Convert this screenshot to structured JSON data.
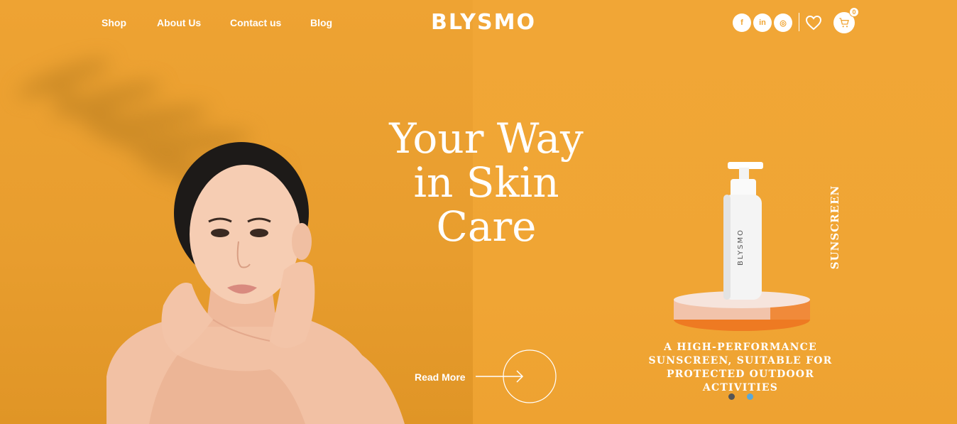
{
  "nav": {
    "links": [
      "Shop",
      "About Us",
      "Contact us",
      "Blog"
    ],
    "logo": "BLYSMO"
  },
  "social": {
    "facebook": "f",
    "linkedin": "in",
    "instagram": "◎"
  },
  "cart": {
    "count": "0"
  },
  "hero": {
    "headline": [
      "Your Way",
      "in Skin",
      "Care"
    ],
    "read_more": "Read More"
  },
  "product": {
    "bottle_brand": "BLYSMO",
    "vertical_label": "SUNSCREEN",
    "description": [
      "A HIGH-PERFORMANCE",
      "SUNSCREEN, SUITABLE FOR",
      "PROTECTED OUTDOOR ACTIVITIES"
    ]
  },
  "slider": {
    "dots": [
      {
        "active": false,
        "color": "#555555"
      },
      {
        "active": true,
        "color": "#5aa8d8"
      }
    ]
  },
  "colors": {
    "accent": "#f0a534",
    "text": "#ffffff"
  }
}
